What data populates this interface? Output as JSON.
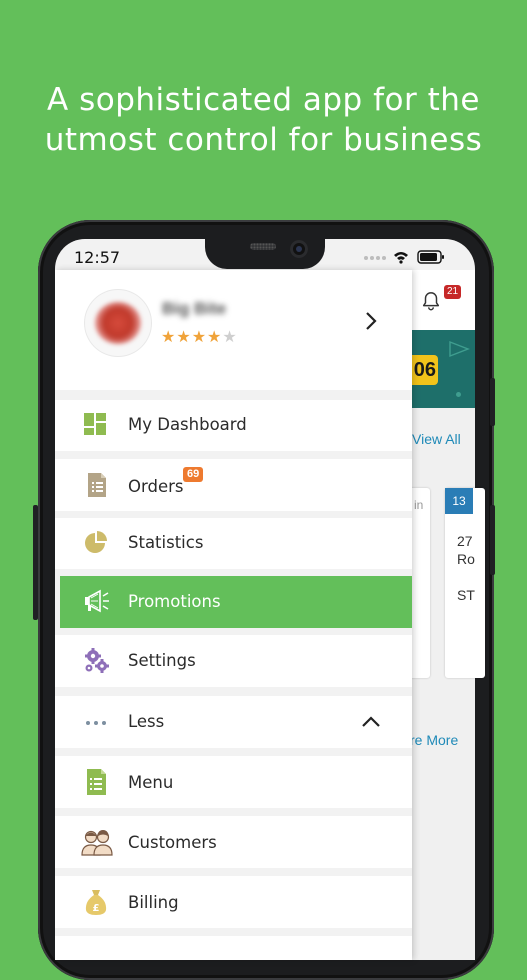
{
  "headline": {
    "line1": "A sophisticated app for the",
    "line2": "utmost control for business"
  },
  "status_bar": {
    "time": "12:57"
  },
  "drawer": {
    "profile": {
      "name": "Big Bite",
      "rating": 4,
      "rating_max": 5
    },
    "items": [
      {
        "label": "My Dashboard",
        "icon": "dashboard-icon"
      },
      {
        "label": "Orders",
        "icon": "orders-icon",
        "badge": "69"
      },
      {
        "label": "Statistics",
        "icon": "pie-chart-icon"
      },
      {
        "label": "Promotions",
        "icon": "megaphone-icon",
        "active": true
      },
      {
        "label": "Settings",
        "icon": "gears-icon"
      },
      {
        "label": "Less",
        "icon": "more-dots-icon"
      },
      {
        "label": "Menu",
        "icon": "menu-book-icon"
      },
      {
        "label": "Customers",
        "icon": "customers-icon"
      },
      {
        "label": "Billing",
        "icon": "money-bag-icon"
      }
    ]
  },
  "background_app": {
    "notification_count": "21",
    "banner_number": "06",
    "view_all": "View All",
    "card1_text": "in",
    "card2_tag": "13",
    "card2_line1": "27",
    "card2_line2": "Ro",
    "card2_line3": "ST",
    "more_link": "re More"
  },
  "colors": {
    "brand_green": "#63bf5a",
    "badge_orange": "#ee7a2f",
    "star": "#f0a33a",
    "link_blue": "#1f8ab8"
  }
}
